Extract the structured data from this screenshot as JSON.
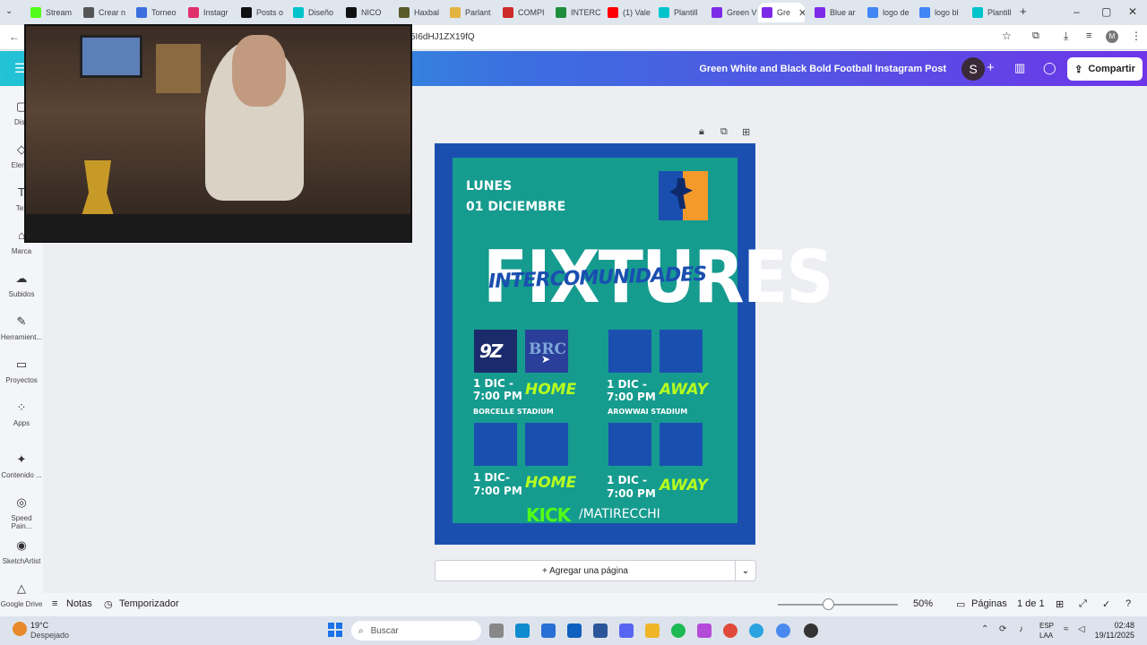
{
  "browser": {
    "tabs": [
      {
        "label": "Stream",
        "color": "#53fc18"
      },
      {
        "label": "Crear n",
        "color": "#555555"
      },
      {
        "label": "Torneo",
        "color": "#3b6fe0"
      },
      {
        "label": "Instagr",
        "color": "#e1306c"
      },
      {
        "label": "Posts o",
        "color": "#111111"
      },
      {
        "label": "Diseño",
        "color": "#00c4cc"
      },
      {
        "label": "NICO",
        "color": "#111111"
      },
      {
        "label": "Haxbal",
        "color": "#5a5a2a"
      },
      {
        "label": "Parlant",
        "color": "#e3b341"
      },
      {
        "label": "COMPI",
        "color": "#cc2a2a"
      },
      {
        "label": "INTERC",
        "color": "#1e8e3e"
      },
      {
        "label": "(1) Vale",
        "color": "#ff0000"
      },
      {
        "label": "Plantill",
        "color": "#00c4cc"
      },
      {
        "label": "Green V",
        "color": "#7d2ae8"
      },
      {
        "label": "Gre",
        "color": "#7d2ae8"
      },
      {
        "label": "Blue ar",
        "color": "#7d2ae8"
      },
      {
        "label": "logo de",
        "color": "#4285f4"
      },
      {
        "label": "logo bl",
        "color": "#4285f4"
      },
      {
        "label": "Plantill",
        "color": "#00c4cc"
      }
    ],
    "url": "5I6dHJ1ZX19fQ"
  },
  "editor": {
    "doc_title": "Green White and Black Bold Football Instagram Post",
    "avatar_letter": "S",
    "share_label": "Compartir",
    "add_page_label": "+ Agregar una página",
    "notes_label": "Notas",
    "timer_label": "Temporizador",
    "zoom": "50%",
    "pages_label": "Páginas",
    "page_count": "1 de 1"
  },
  "sidebar": [
    {
      "label": "Dise",
      "icon": "layout-icon",
      "glyph": "▢"
    },
    {
      "label": "Eleme",
      "icon": "elements-icon",
      "glyph": "◇"
    },
    {
      "label": "Tex",
      "icon": "text-icon",
      "glyph": "T"
    },
    {
      "label": "Marca",
      "icon": "brand-icon",
      "glyph": "⌂"
    },
    {
      "label": "Subidos",
      "icon": "upload-cloud-icon",
      "glyph": "☁"
    },
    {
      "label": "Herramient...",
      "icon": "pen-tool-icon",
      "glyph": "✎"
    },
    {
      "label": "Proyectos",
      "icon": "folder-icon",
      "glyph": "▭"
    },
    {
      "label": "Apps",
      "icon": "apps-grid-icon",
      "glyph": "⁘"
    },
    {
      "label": "Contenido ...",
      "icon": "magic-content-icon",
      "glyph": "✦"
    },
    {
      "label": "Speed Pain...",
      "icon": "speed-paint-icon",
      "glyph": "◎"
    },
    {
      "label": "SketchArtist",
      "icon": "sketch-artist-icon",
      "glyph": "◉"
    },
    {
      "label": "Google Drive",
      "icon": "google-drive-icon",
      "glyph": "△"
    }
  ],
  "design": {
    "day": "LUNES",
    "date": "01 DICIEMBRE",
    "title": "FIXTURES",
    "subtitle": "INTERCOMUNIDADES",
    "matches": [
      {
        "date": "1 DIC -",
        "time": "7:00 PM",
        "tag": "HOME",
        "stadium": "BORCELLE STADIUM"
      },
      {
        "date": "1 DIC -",
        "time": "7:00 PM",
        "tag": "AWAY",
        "stadium": "AROWWAI STADIUM"
      },
      {
        "date": "1 DIC-",
        "time": "7:00 PM",
        "tag": "HOME",
        "stadium": ""
      },
      {
        "date": "1 DIC -",
        "time": "7:00 PM",
        "tag": "AWAY",
        "stadium": ""
      }
    ],
    "team_logo_1": "BRC",
    "footer_brand": "KICK",
    "footer_handle": "/MATIRECCHI",
    "colors": {
      "page": "#1a4fb0",
      "panel": "#169b8f",
      "accent": "#b8ff1e"
    }
  },
  "taskbar": {
    "weather_temp": "19°C",
    "weather_desc": "Despejado",
    "search_placeholder": "Buscar",
    "lang_1": "ESP",
    "lang_2": "LAA",
    "time": "02:48",
    "date": "19/11/2025"
  }
}
